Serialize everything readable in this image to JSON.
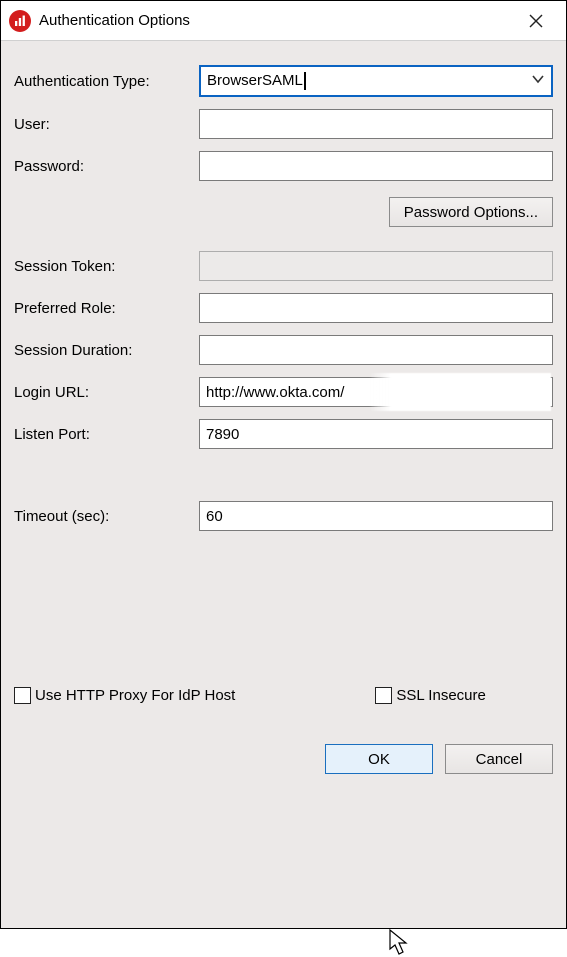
{
  "window": {
    "title": "Authentication Options"
  },
  "labels": {
    "auth_type": "Authentication Type:",
    "user": "User:",
    "password": "Password:",
    "password_options": "Password Options...",
    "session_token": "Session Token:",
    "preferred_role": "Preferred Role:",
    "session_duration": "Session Duration:",
    "login_url": "Login URL:",
    "listen_port": "Listen Port:",
    "timeout": "Timeout (sec):",
    "http_proxy": "Use HTTP Proxy For IdP Host",
    "ssl_insecure": "SSL Insecure",
    "ok": "OK",
    "cancel": "Cancel"
  },
  "values": {
    "auth_type": "BrowserSAML",
    "user": "",
    "password": "",
    "session_token": "",
    "preferred_role": "",
    "session_duration": "",
    "login_url": "http://www.okta.com/",
    "listen_port": "7890",
    "timeout": "60",
    "http_proxy_checked": false,
    "ssl_insecure_checked": false
  }
}
